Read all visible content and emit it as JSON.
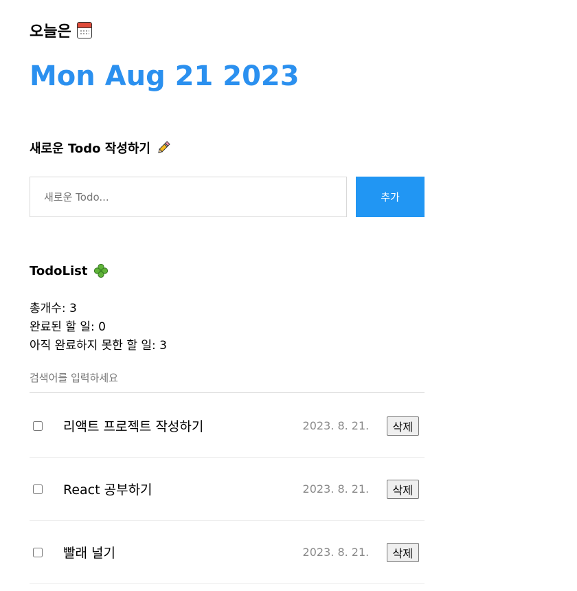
{
  "header": {
    "title": "오늘은",
    "calendar_icon": "calendar-icon",
    "date": "Mon Aug 21 2023"
  },
  "editor": {
    "title": "새로운 Todo 작성하기",
    "pencil_icon": "pencil-icon",
    "input_placeholder": "새로운 Todo...",
    "input_value": "",
    "add_label": "추가",
    "accent_color": "#2196f3"
  },
  "list": {
    "title": "TodoList",
    "clover_icon": "clover-icon",
    "total": "총개수: 3",
    "done": "완료된 할 일: 0",
    "not_done": "아직 완료하지 못한 할 일: 3",
    "search_placeholder": "검색어를 입력하세요",
    "items": [
      {
        "content": "리액트 프로젝트 작성하기",
        "date": "2023. 8. 21.",
        "checked": false,
        "delete_label": "삭제"
      },
      {
        "content": "React 공부하기",
        "date": "2023. 8. 21.",
        "checked": false,
        "delete_label": "삭제"
      },
      {
        "content": "빨래 널기",
        "date": "2023. 8. 21.",
        "checked": false,
        "delete_label": "삭제"
      }
    ]
  }
}
